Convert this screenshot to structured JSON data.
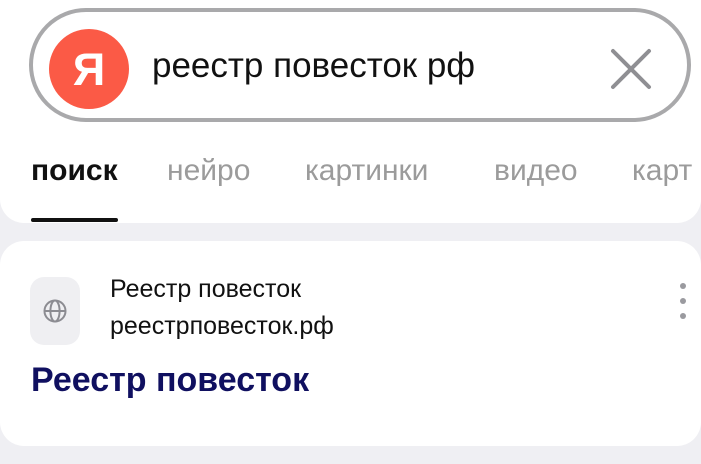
{
  "search": {
    "logo_text": "Я",
    "query": "реестр повесток рф"
  },
  "icons": {
    "logo": "yandex-logo-icon",
    "clear": "close-icon",
    "favicon": "globe-icon",
    "more": "more-vertical-icon"
  },
  "tabs": [
    {
      "label": "поиск",
      "active": true
    },
    {
      "label": "нейро",
      "active": false
    },
    {
      "label": "картинки",
      "active": false
    },
    {
      "label": "видео",
      "active": false
    },
    {
      "label": "карт",
      "active": false
    }
  ],
  "result": {
    "site_name": "Реестр повесток",
    "url": "реестрповесток.рф",
    "title": "Реестр повесток"
  },
  "colors": {
    "background": "#efeff3",
    "logo": "#fb5a46",
    "search_border": "#a9a9ab",
    "active_tab": "#111111",
    "inactive_tab": "#9b9b9b",
    "result_title": "#101060"
  }
}
